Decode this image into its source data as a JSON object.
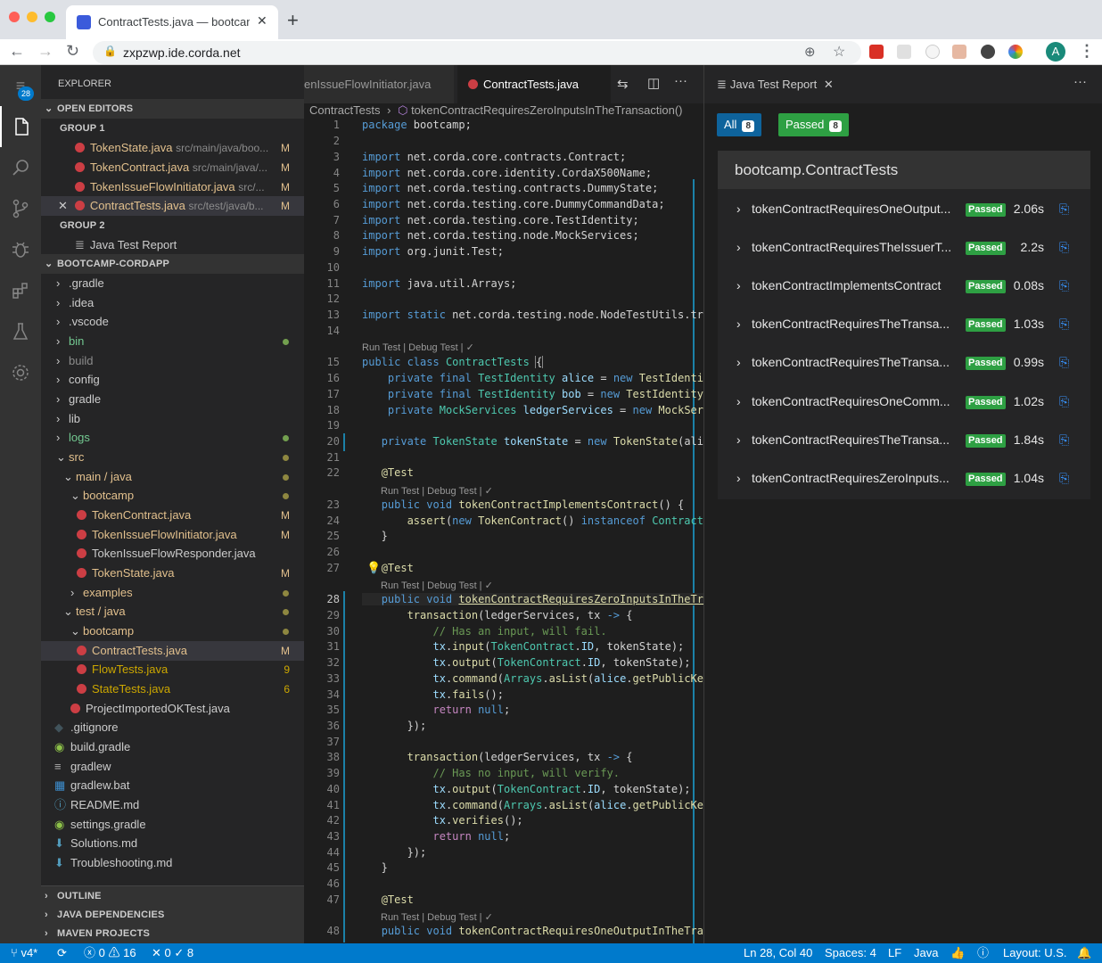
{
  "browser": {
    "tab_title": "ContractTests.java — bootcamp",
    "new_tab": "+",
    "url": "zxpzwp.ide.corda.net",
    "profile_initial": "A"
  },
  "explorer": {
    "title": "EXPLORER",
    "open_editors": "OPEN EDITORS",
    "group1": "GROUP 1",
    "group2": "GROUP 2",
    "open_files": [
      {
        "name": "TokenState.java",
        "path": "src/main/java/boo...",
        "badge": "M"
      },
      {
        "name": "TokenContract.java",
        "path": "src/main/java/...",
        "badge": "M"
      },
      {
        "name": "TokenIssueFlowInitiator.java",
        "path": "src/...",
        "badge": "M"
      },
      {
        "name": "ContractTests.java",
        "path": "src/test/java/b...",
        "badge": "M"
      }
    ],
    "group2_item": "Java Test Report",
    "project": "BOOTCAMP-CORDAPP",
    "tree": [
      {
        "label": ".gradle"
      },
      {
        "label": ".idea"
      },
      {
        "label": ".vscode"
      },
      {
        "label": "bin"
      },
      {
        "label": "build"
      },
      {
        "label": "config"
      },
      {
        "label": "gradle"
      },
      {
        "label": "lib"
      },
      {
        "label": "logs"
      },
      {
        "label": "src"
      },
      {
        "label": "main / java"
      },
      {
        "label": "bootcamp"
      },
      {
        "label": "TokenContract.java",
        "badge": "M"
      },
      {
        "label": "TokenIssueFlowInitiator.java",
        "badge": "M"
      },
      {
        "label": "TokenIssueFlowResponder.java"
      },
      {
        "label": "TokenState.java",
        "badge": "M"
      },
      {
        "label": "examples"
      },
      {
        "label": "test / java"
      },
      {
        "label": "bootcamp"
      },
      {
        "label": "ContractTests.java",
        "badge": "M"
      },
      {
        "label": "FlowTests.java",
        "badge": "9"
      },
      {
        "label": "StateTests.java",
        "badge": "6"
      },
      {
        "label": "ProjectImportedOKTest.java"
      },
      {
        "label": ".gitignore"
      },
      {
        "label": "build.gradle"
      },
      {
        "label": "gradlew"
      },
      {
        "label": "gradlew.bat"
      },
      {
        "label": "README.md"
      },
      {
        "label": "settings.gradle"
      },
      {
        "label": "Solutions.md"
      },
      {
        "label": "Troubleshooting.md"
      }
    ],
    "outline": "OUTLINE",
    "java_deps": "JAVA DEPENDENCIES",
    "maven": "MAVEN PROJECTS",
    "scm_badge": "28"
  },
  "editor": {
    "tab_inactive": "enIssueFlowInitiator.java",
    "tab_active": "ContractTests.java",
    "breadcrumb_file": "ContractTests",
    "breadcrumb_method": "tokenContractRequiresZeroInputsInTheTransaction()",
    "lens_class": "Run Test | Debug Test | ✓",
    "lens_method": "Run Test | Debug Test | ✓",
    "line_numbers": [
      "1",
      "2",
      "3",
      "4",
      "5",
      "6",
      "7",
      "8",
      "9",
      "10",
      "11",
      "12",
      "13",
      "14",
      "15",
      "16",
      "17",
      "18",
      "19",
      "20",
      "21",
      "22",
      "23",
      "24",
      "25",
      "26",
      "27",
      "28",
      "29",
      "30",
      "31",
      "32",
      "33",
      "34",
      "35",
      "36",
      "37",
      "38",
      "39",
      "40",
      "41",
      "42",
      "43",
      "44",
      "45",
      "46",
      "47",
      "48"
    ]
  },
  "report": {
    "tab_title": "Java Test Report",
    "all_label": "All",
    "all_count": "8",
    "passed_label": "Passed",
    "passed_count": "8",
    "suite": "bootcamp.ContractTests",
    "tests": [
      {
        "name": "tokenContractRequiresOneOutput...",
        "status": "Passed",
        "duration": "2.06s"
      },
      {
        "name": "tokenContractRequiresTheIssuerT...",
        "status": "Passed",
        "duration": "2.2s"
      },
      {
        "name": "tokenContractImplementsContract",
        "status": "Passed",
        "duration": "0.08s"
      },
      {
        "name": "tokenContractRequiresTheTransa...",
        "status": "Passed",
        "duration": "1.03s"
      },
      {
        "name": "tokenContractRequiresTheTransa...",
        "status": "Passed",
        "duration": "0.99s"
      },
      {
        "name": "tokenContractRequiresOneComm...",
        "status": "Passed",
        "duration": "1.02s"
      },
      {
        "name": "tokenContractRequiresTheTransa...",
        "status": "Passed",
        "duration": "1.84s"
      },
      {
        "name": "tokenContractRequiresZeroInputs...",
        "status": "Passed",
        "duration": "1.04s"
      }
    ]
  },
  "status_bar": {
    "branch": "v4*",
    "errors": "0",
    "warnings": "16",
    "tests": "0 ✓ 8",
    "position": "Ln 28, Col 40",
    "spaces": "Spaces: 4",
    "eol": "LF",
    "language": "Java",
    "layout": "Layout: U.S."
  },
  "colors": {
    "accent": "#007acc",
    "passed": "#2ea043",
    "java_icon": "#cc3e44"
  }
}
